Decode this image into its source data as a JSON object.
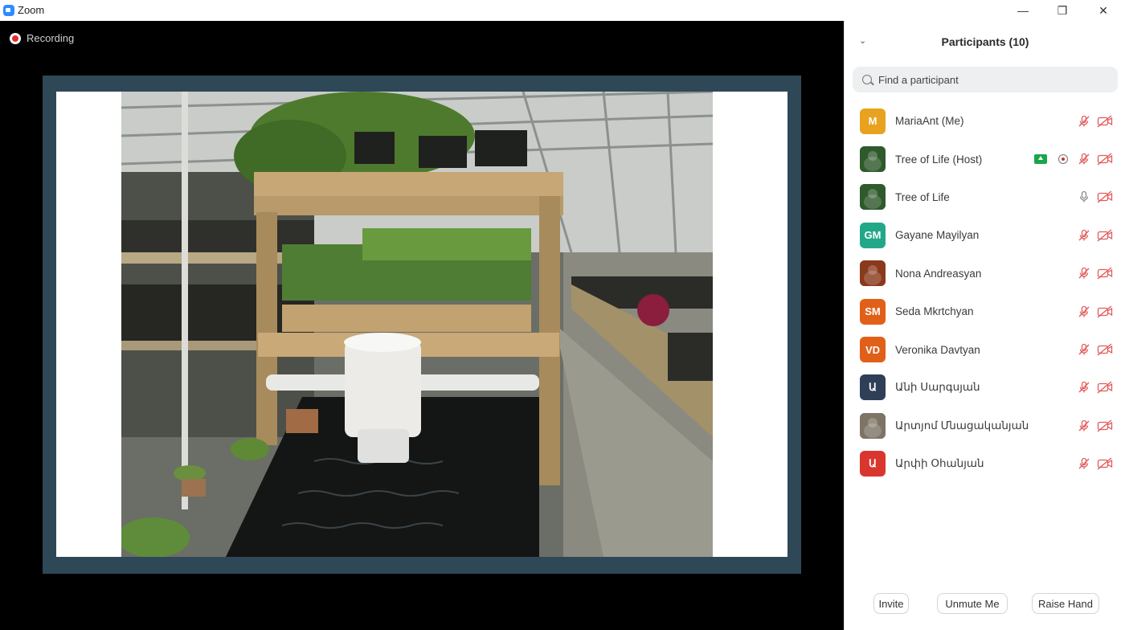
{
  "window": {
    "title": "Zoom",
    "controls": {
      "minimize": "—",
      "restore": "❐",
      "close": "✕"
    }
  },
  "meeting": {
    "recording_label": "Recording"
  },
  "panel": {
    "title": "Participants (10)",
    "search_placeholder": "Find a participant",
    "participants": [
      {
        "name": "MariaAnt (Me)",
        "initials": "M",
        "avatar_color": "#e8a21e",
        "muted": true,
        "video_off": true
      },
      {
        "name": "Tree of Life (Host)",
        "initials": "",
        "avatar_color": "#2f5a2c",
        "muted": true,
        "video_off": true,
        "sharing": true,
        "recording": true
      },
      {
        "name": "Tree of Life",
        "initials": "",
        "avatar_color": "#2f5a2c",
        "muted": false,
        "video_off": true
      },
      {
        "name": "Gayane Mayilyan",
        "initials": "GM",
        "avatar_color": "#22a889",
        "muted": true,
        "video_off": true
      },
      {
        "name": "Nona Andreasyan",
        "initials": "",
        "avatar_color": "#8a3a1c",
        "muted": true,
        "video_off": true
      },
      {
        "name": "Seda Mkrtchyan",
        "initials": "SM",
        "avatar_color": "#e0601a",
        "muted": true,
        "video_off": true
      },
      {
        "name": "Veronika Davtyan",
        "initials": "VD",
        "avatar_color": "#e0601a",
        "muted": true,
        "video_off": true
      },
      {
        "name": "Անի Սարգսյան",
        "initials": "Ա",
        "avatar_color": "#2f3f57",
        "muted": true,
        "video_off": true
      },
      {
        "name": "Արտյոմ Մնացականյան",
        "initials": "",
        "avatar_color": "#7d7466",
        "muted": true,
        "video_off": true
      },
      {
        "name": "Արփի Օհանյան",
        "initials": "Ա",
        "avatar_color": "#d9362e",
        "muted": true,
        "video_off": true
      }
    ]
  },
  "footer": {
    "invite_label": "Invite",
    "unmute_label": "Unmute Me",
    "raise_hand_label": "Raise Hand"
  },
  "colors": {
    "muted_red": "#e25a5a",
    "share_green": "#19a64b",
    "frame": "#2f4858"
  }
}
